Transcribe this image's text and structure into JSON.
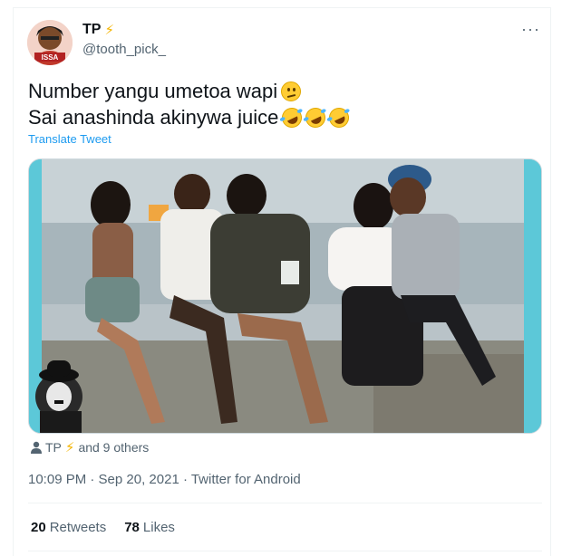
{
  "author": {
    "name": "TP",
    "handle": "@tooth_pick_",
    "avatar_text": "ISSA",
    "verified_emoji": "lightning-bolt"
  },
  "menu": {
    "more_label": "···"
  },
  "tweet": {
    "line1": "Number yangu umetoa wapi",
    "line2": "Sai anashinda akinywa juice",
    "translate_label": "Translate Tweet"
  },
  "tagged": {
    "name": "TP",
    "suffix": "and 9 others"
  },
  "meta": {
    "text": "10:09 PM · Sep 20, 2021 · Twitter for Android"
  },
  "stats": {
    "retweets_count": "20",
    "retweets_label": "Retweets",
    "likes_count": "78",
    "likes_label": "Likes"
  },
  "colors": {
    "link": "#1d9bf0",
    "secondary_text": "#536471",
    "bolt": "#f4b400",
    "media_border": "#5cc8d8"
  }
}
